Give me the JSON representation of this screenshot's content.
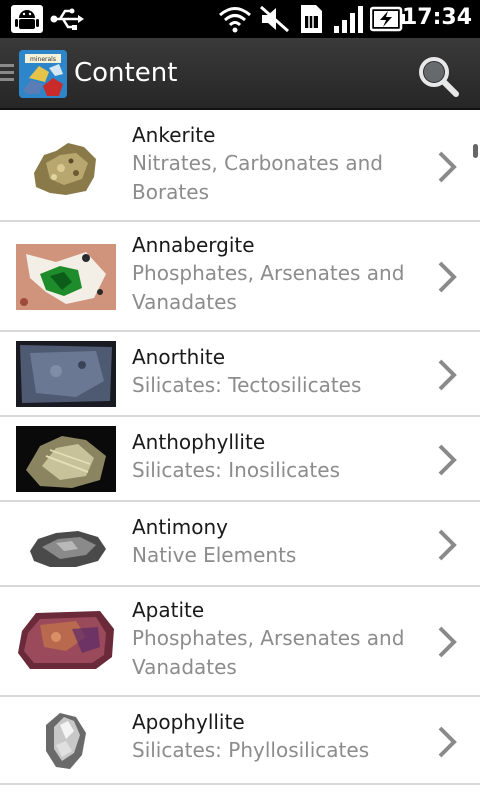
{
  "status_bar": {
    "time": "17:34",
    "icons": [
      "android-debug-icon",
      "usb-icon",
      "wifi-icon",
      "mute-icon",
      "sim-icon",
      "signal-icon",
      "battery-charging-icon"
    ]
  },
  "action_bar": {
    "title": "Content",
    "logo_text": "minerals"
  },
  "list": [
    {
      "name": "Ankerite",
      "category": "Nitrates, Carbonates and Borates",
      "thumb": "ankerite"
    },
    {
      "name": "Annabergite",
      "category": "Phosphates, Arsenates and Vanadates",
      "thumb": "annabergite"
    },
    {
      "name": "Anorthite",
      "category": "Silicates: Tectosilicates",
      "thumb": "anorthite"
    },
    {
      "name": "Anthophyllite",
      "category": "Silicates: Inosilicates",
      "thumb": "anthophyllite"
    },
    {
      "name": "Antimony",
      "category": "Native Elements",
      "thumb": "antimony"
    },
    {
      "name": "Apatite",
      "category": "Phosphates, Arsenates and Vanadates",
      "thumb": "apatite"
    },
    {
      "name": "Apophyllite",
      "category": "Silicates: Phyllosilicates",
      "thumb": "apophyllite"
    }
  ],
  "colors": {
    "action_bar": "#2f2f2f",
    "title_text": "#ffffff",
    "item_name": "#1a1a1a",
    "item_category": "#8c8c8c",
    "divider": "#d8d8d8",
    "chevron": "#8a8a8a"
  }
}
